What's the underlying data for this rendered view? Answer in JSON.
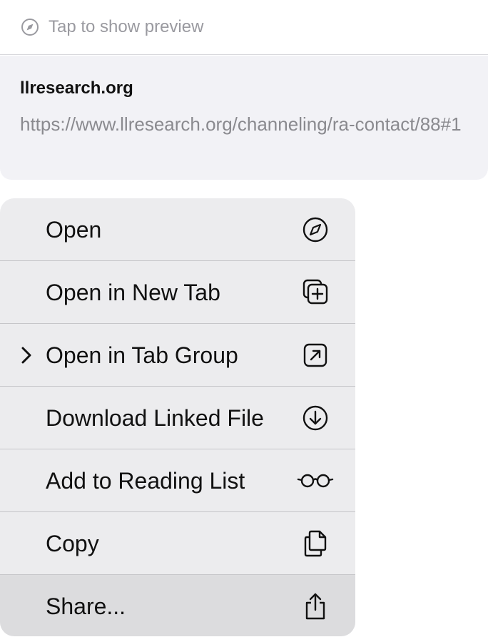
{
  "preview": {
    "icon": "compass-icon",
    "label": "Tap to show preview"
  },
  "link": {
    "domain": "llresearch.org",
    "url": "https://www.llresearch.org/channeling/ra-contact/88#1"
  },
  "menu": {
    "items": [
      {
        "label": "Open",
        "icon": "compass-icon",
        "has_submenu": false,
        "highlighted": false
      },
      {
        "label": "Open in New Tab",
        "icon": "plus-square-on-square-icon",
        "has_submenu": false,
        "highlighted": false
      },
      {
        "label": "Open in Tab Group",
        "icon": "arrow-up-right-square-icon",
        "has_submenu": true,
        "highlighted": false
      },
      {
        "label": "Download Linked File",
        "icon": "arrow-down-circle-icon",
        "has_submenu": false,
        "highlighted": false
      },
      {
        "label": "Add to Reading List",
        "icon": "eyeglasses-icon",
        "has_submenu": false,
        "highlighted": false
      },
      {
        "label": "Copy",
        "icon": "doc-on-doc-icon",
        "has_submenu": false,
        "highlighted": false
      },
      {
        "label": "Share...",
        "icon": "share-icon",
        "has_submenu": false,
        "highlighted": true
      }
    ]
  },
  "colors": {
    "menu_background": "#ececee",
    "highlight": "#dcdcde",
    "card_background": "#f2f2f6",
    "secondary_text": "#8a8a8f"
  }
}
